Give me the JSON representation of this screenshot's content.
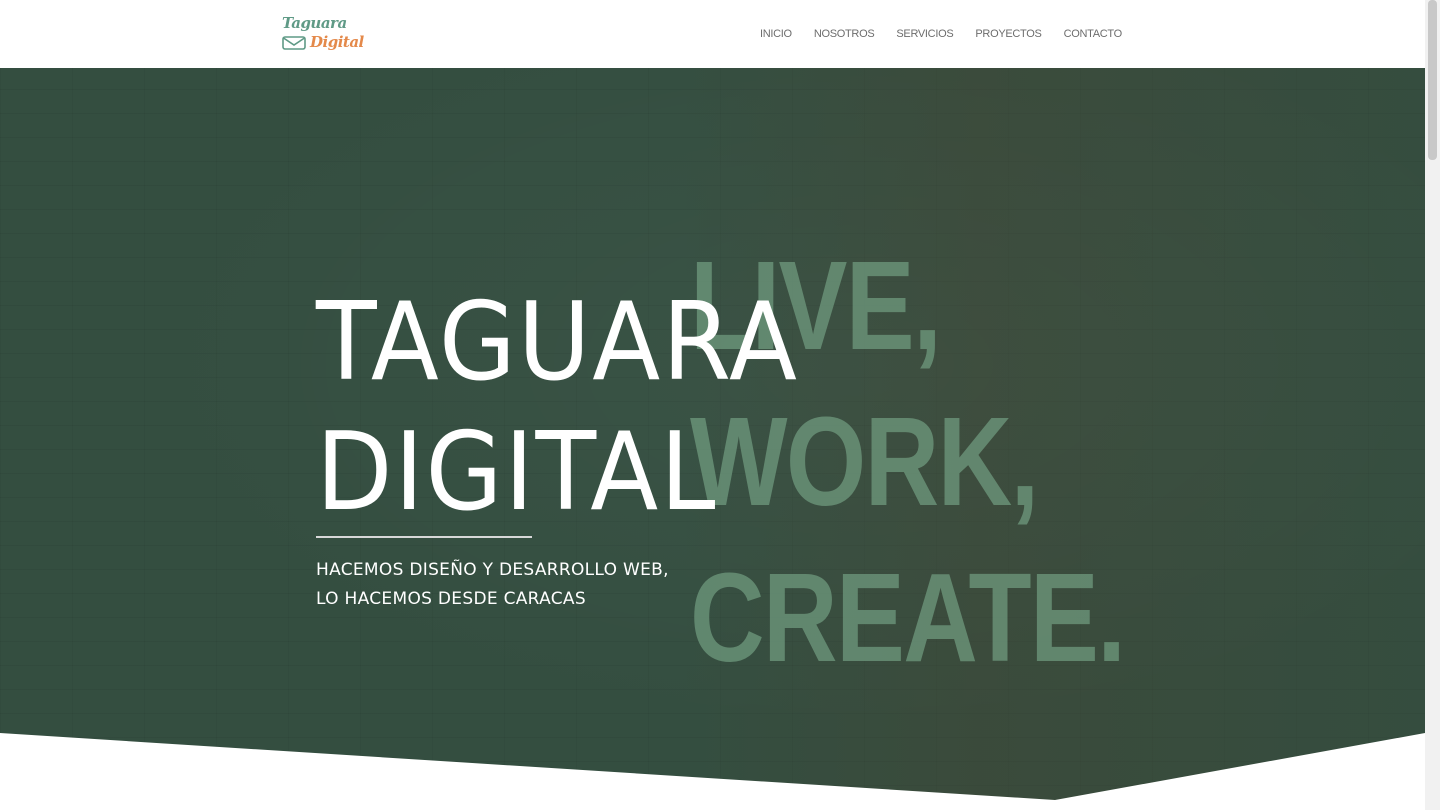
{
  "header": {
    "logo": {
      "line1": "Taguara",
      "line2": "Digital",
      "icon": "envelope-icon"
    },
    "nav": [
      {
        "label": "INICIO"
      },
      {
        "label": "NOSOTROS"
      },
      {
        "label": "SERVICIOS"
      },
      {
        "label": "PROYECTOS"
      },
      {
        "label": "CONTACTO"
      }
    ]
  },
  "hero": {
    "title_line1": "TAGUARA",
    "title_line2": "DIGITAL",
    "subtitle_line1": "HACEMOS DISEÑO Y DESARROLLO WEB,",
    "subtitle_line2": "LO HACEMOS DESDE CARACAS",
    "background_text": [
      "LIVE,",
      "WORK,",
      "CREATE."
    ]
  },
  "colors": {
    "hero_bg": "#344e40",
    "logo_green": "#5f9a86",
    "logo_orange": "#e4894a",
    "nav_text": "#6d6d6d"
  }
}
